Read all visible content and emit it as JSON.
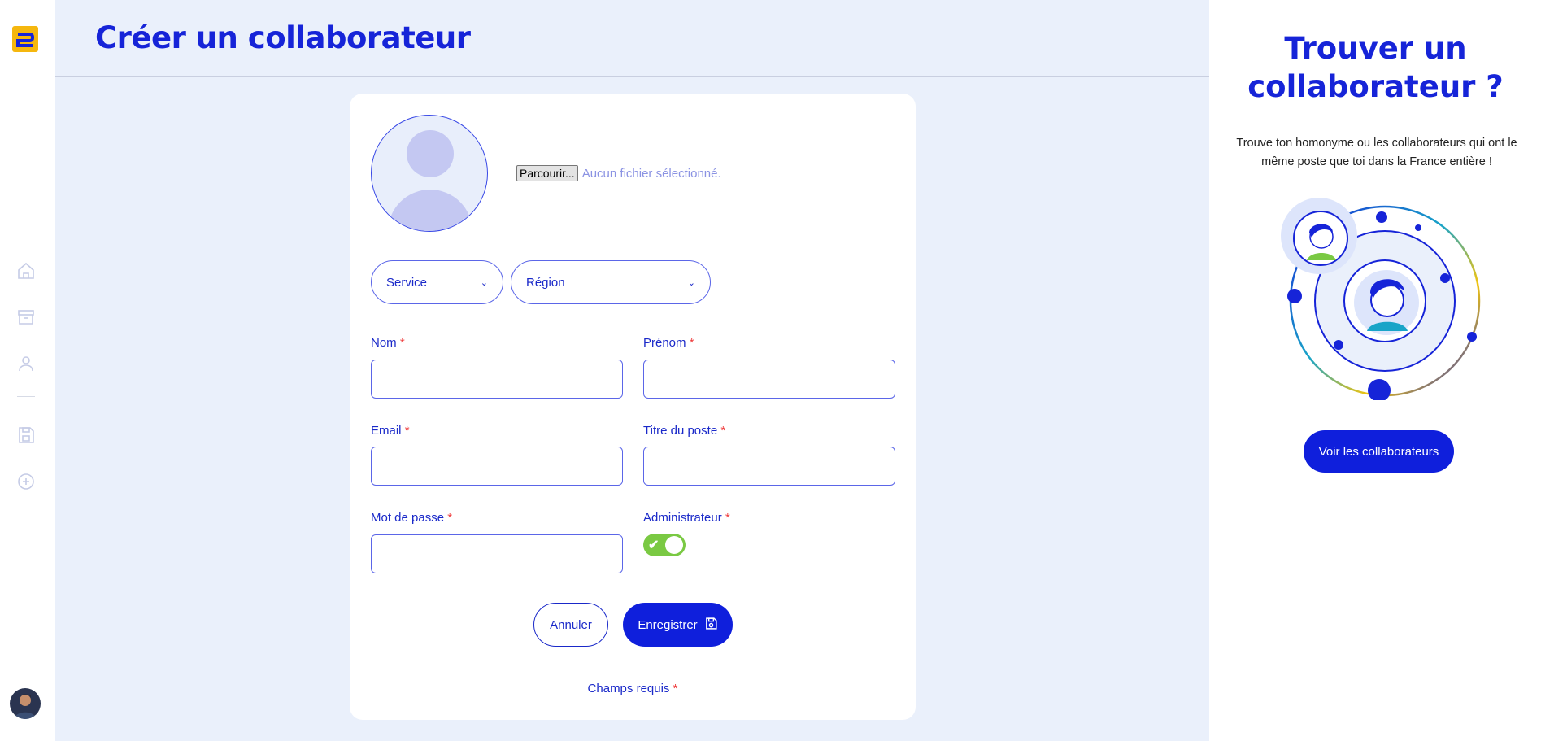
{
  "page": {
    "title": "Créer un collaborateur"
  },
  "sidebar": {
    "logo": "logo-icon",
    "items": [
      {
        "name": "home-icon"
      },
      {
        "name": "archive-icon"
      },
      {
        "name": "user-icon"
      },
      {
        "name": "save-icon"
      },
      {
        "name": "add-circle-icon"
      }
    ]
  },
  "form": {
    "photo": {
      "button_label": "Parcourir...",
      "status": "Aucun fichier sélectionné."
    },
    "selects": {
      "service": "Service",
      "region": "Région"
    },
    "fields": {
      "nom": "Nom",
      "prenom": "Prénom",
      "email": "Email",
      "titre": "Titre du poste",
      "password": "Mot de passe",
      "admin": "Administrateur"
    },
    "required_mark": "*",
    "admin_enabled": true,
    "buttons": {
      "cancel": "Annuler",
      "save": "Enregistrer"
    },
    "required_note": "Champs requis"
  },
  "right_panel": {
    "title": "Trouver un collaborateur ?",
    "text": "Trouve ton homonyme ou les collaborateurs qui ont le même poste que toi dans la France entière !",
    "button": "Voir les collaborateurs"
  },
  "colors": {
    "primary": "#0f1fdc",
    "background": "#eaf0fb",
    "required": "#ef3d3d",
    "toggle_on": "#7ac943",
    "logo_yellow": "#f5b70e"
  }
}
